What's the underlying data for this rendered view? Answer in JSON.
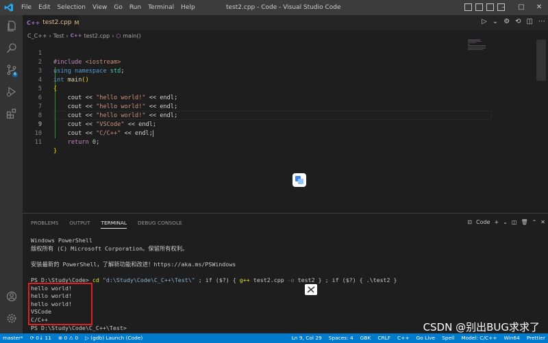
{
  "titlebar": {
    "menu": [
      "File",
      "Edit",
      "Selection",
      "View",
      "Go",
      "Run",
      "Terminal",
      "Help"
    ],
    "window_title": "test2.cpp - Code - Visual Studio Code",
    "controls": [
      "–",
      "□",
      "✕"
    ]
  },
  "activitybar": {
    "scm_badge": "6"
  },
  "tab": {
    "icon": "C++",
    "name": "test2.cpp",
    "modified": "M"
  },
  "breadcrumb": {
    "root": "C_C++",
    "folder": "Test",
    "file_icon": "C++",
    "file": "test2.cpp",
    "symbol": "main()"
  },
  "editor": {
    "lines": [
      {
        "n": "1"
      },
      {
        "n": "2"
      },
      {
        "n": "3"
      },
      {
        "n": "4"
      },
      {
        "n": "5"
      },
      {
        "n": "6"
      },
      {
        "n": "7"
      },
      {
        "n": "8"
      },
      {
        "n": "9"
      },
      {
        "n": "10"
      },
      {
        "n": "11"
      }
    ],
    "code": {
      "l1_k": "#include",
      "l1_s": " <iostream>",
      "l2_a": "using",
      "l2_b": " namespace",
      "l2_c": " std",
      "l3_a": "int",
      "l3_b": " main",
      "l3_c": "()",
      "l4": "{",
      "cout": "cout",
      "op": " << ",
      "endl": "endl",
      "hello": "\"hello world!\"",
      "vscode": "\"VSCode\"",
      "cpp": "\"C/C++\"",
      "semi": ";",
      "ret": "return",
      "zero": " 0",
      "l11": "}"
    }
  },
  "panel": {
    "tabs": [
      "PROBLEMS",
      "OUTPUT",
      "TERMINAL",
      "DEBUG CONSOLE"
    ],
    "shell_label": "Code"
  },
  "terminal": {
    "l1": "Windows PowerShell",
    "l2": "版权所有 (C) Microsoft Corporation。保留所有权利。",
    "l3": "",
    "l4": "安装最新的 PowerShell，了解新功能和改进！https://aka.ms/PSWindows",
    "l5": "",
    "l6_prompt": "PS D:\\Study\\Code> ",
    "l6_cd": "cd",
    "l6_path": " \"d:\\Study\\Code\\C_C++\\Test\\\"",
    "l6_rest1": " ; if ($?) { ",
    "l6_gpp": "g++",
    "l6_rest2": " test2.cpp ",
    "l6_o": "-o",
    "l6_rest3": " test2 } ; if ($?) { .\\test2 }",
    "out": [
      "hello world!",
      "hello world!",
      "hello world!",
      "VSCode",
      "C/C++"
    ],
    "last": "PS D:\\Study\\Code\\C_C++\\Test>"
  },
  "statusbar": {
    "left": [
      "master*",
      "⟳ 0↓ 11",
      "⊗ 0 ⚠ 0",
      "▷ (gdb) Launch (Code)"
    ],
    "right": [
      "Ln 9, Col 29",
      "Spaces: 4",
      "GBK",
      "CRLF",
      "C++",
      "Go Live",
      "Spell",
      "Model: C/C++",
      "Win64",
      "Prettier"
    ]
  },
  "watermark": "CSDN @别出BUG求求了"
}
